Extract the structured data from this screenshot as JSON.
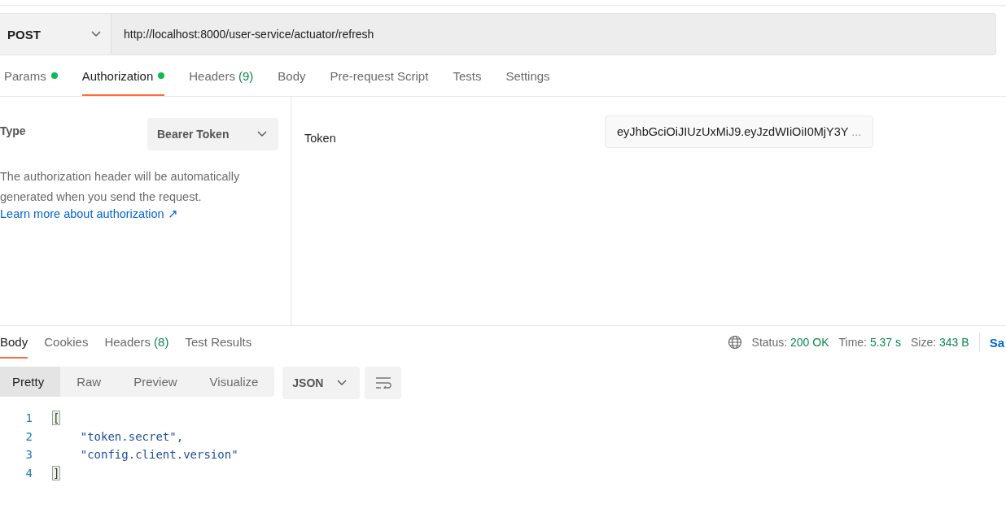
{
  "request": {
    "method": "POST",
    "url": "http://localhost:8000/user-service/actuator/refresh"
  },
  "request_tabs": [
    {
      "label": "Params",
      "dot": true,
      "selected": false
    },
    {
      "label": "Authorization",
      "dot": true,
      "selected": true
    },
    {
      "label": "Headers",
      "dot": false,
      "count": "(9)",
      "selected": false
    },
    {
      "label": "Body",
      "dot": false,
      "selected": false
    },
    {
      "label": "Pre-request Script",
      "dot": false,
      "selected": false
    },
    {
      "label": "Tests",
      "dot": false,
      "selected": false
    },
    {
      "label": "Settings",
      "dot": false,
      "selected": false
    }
  ],
  "auth": {
    "type_label": "Type",
    "type_value": "Bearer Token",
    "description": "The authorization header will be automatically generated when you send the request.",
    "link": "Learn more about authorization ↗",
    "token_label": "Token",
    "token_value": "eyJhbGciOiJIUzUxMiJ9.eyJzdWIiOiI0MjY3Y",
    "overflow_mark": "..."
  },
  "response_tabs": [
    {
      "label": "Body",
      "selected": true
    },
    {
      "label": "Cookies",
      "selected": false
    },
    {
      "label": "Headers",
      "count": "(8)",
      "selected": false
    },
    {
      "label": "Test Results",
      "selected": false
    }
  ],
  "status": [
    {
      "label": "Status:",
      "value": "200 OK"
    },
    {
      "label": "Time:",
      "value": "5.37 s"
    },
    {
      "label": "Size:",
      "value": "343 B"
    }
  ],
  "save_link": "Sa",
  "view_modes": [
    {
      "label": "Pretty",
      "selected": true
    },
    {
      "label": "Raw",
      "selected": false
    },
    {
      "label": "Preview",
      "selected": false
    },
    {
      "label": "Visualize",
      "selected": false
    }
  ],
  "format": "JSON",
  "code_lines": [
    {
      "number": "1",
      "text": "[",
      "highlighted": true
    },
    {
      "number": "2",
      "text": "    \"token.secret\",",
      "highlighted": false
    },
    {
      "number": "3",
      "text": "    \"config.client.version\"",
      "highlighted": false
    },
    {
      "number": "4",
      "text": "]",
      "highlighted": true
    }
  ]
}
